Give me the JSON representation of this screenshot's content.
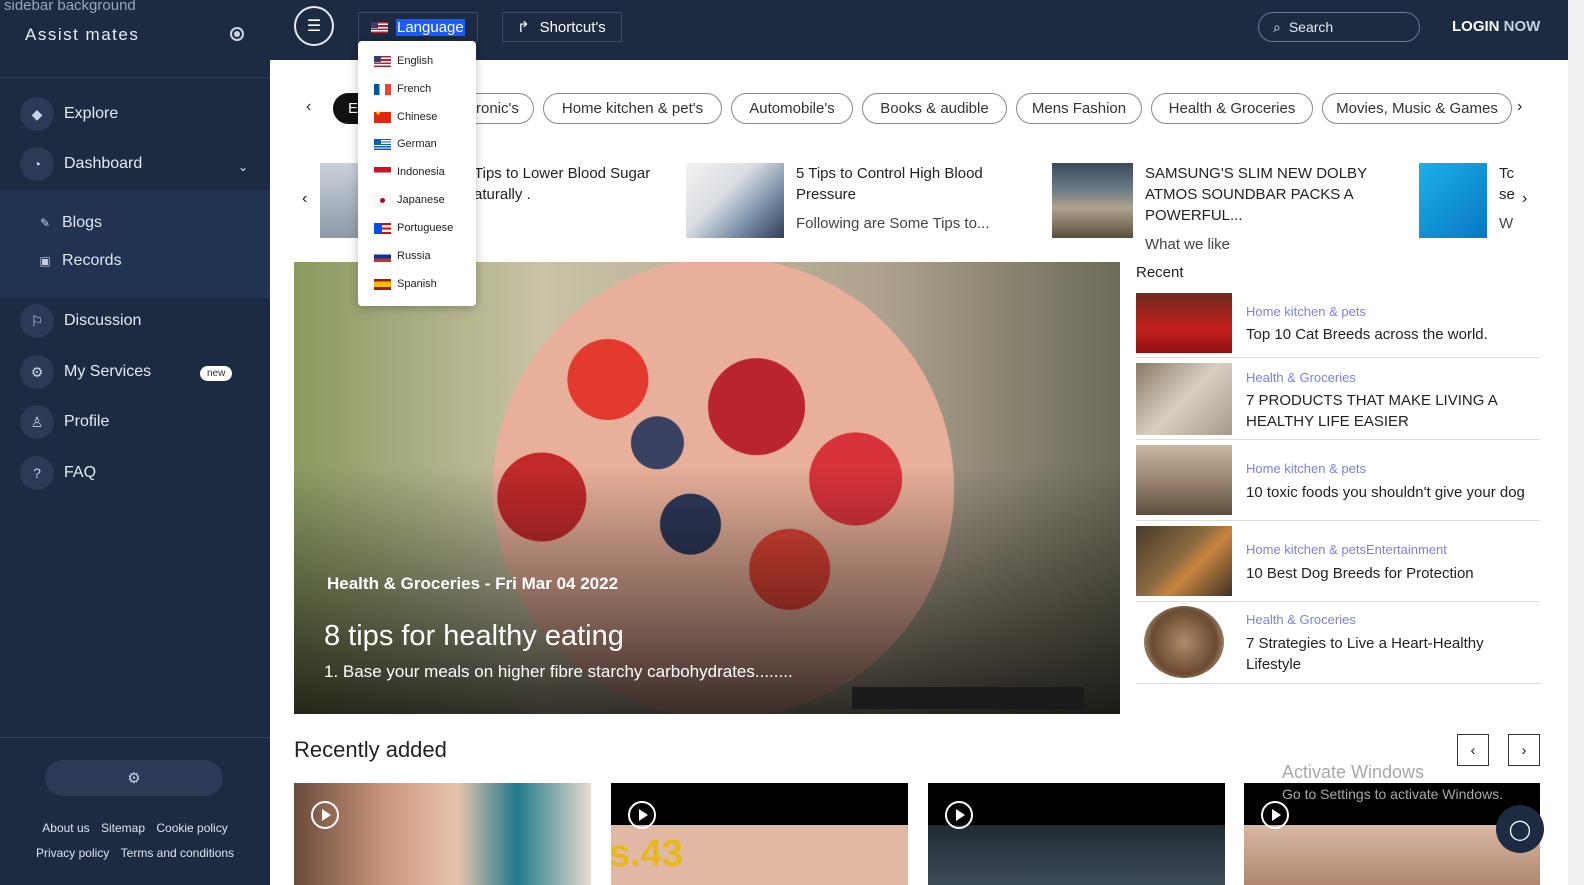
{
  "sidebar": {
    "bg_alt_text": "sidebar background",
    "brand": "Assist mates",
    "nav": [
      {
        "label": "Explore",
        "icon": "gem-icon"
      },
      {
        "label": "Dashboard",
        "icon": "gauge-icon"
      },
      {
        "label": "Discussion",
        "icon": "discussion-icon"
      },
      {
        "label": "My Services",
        "icon": "services-icon",
        "badge": "new"
      },
      {
        "label": "Profile",
        "icon": "profile-icon"
      },
      {
        "label": "FAQ",
        "icon": "question-icon"
      }
    ],
    "sub": [
      {
        "label": "Blogs",
        "icon": "pen-icon"
      },
      {
        "label": "Records",
        "icon": "video-icon"
      }
    ],
    "footer_links": [
      "About us",
      "Sitemap",
      "Cookie policy",
      "Privacy policy",
      "Terms and conditions"
    ]
  },
  "topbar": {
    "language_label": "Language",
    "shortcut_label": "Shortcut's",
    "search_placeholder": "Search",
    "login_label": "LOGIN",
    "login_now": "NOW"
  },
  "languages": [
    "English",
    "French",
    "Chinese",
    "German",
    "Indonesia",
    "Japanese",
    "Portuguese",
    "Russia",
    "Spanish"
  ],
  "categories": {
    "active_partial": "E",
    "items": [
      "ronic's",
      "Home kitchen & pet's",
      "Automobile's",
      "Books & audible",
      "Mens Fashion",
      "Health & Groceries",
      "Movies, Music & Games"
    ]
  },
  "news": [
    {
      "title": "Tips to Lower Blood Sugar aturally .",
      "sub": ""
    },
    {
      "title": "5 Tips to Control High Blood Pressure",
      "sub": "Following are Some Tips to..."
    },
    {
      "title": "SAMSUNG'S SLIM NEW DOLBY ATMOS SOUNDBAR PACKS A POWERFUL...",
      "sub": "What we like"
    },
    {
      "title": "Tc se",
      "sub": "W"
    }
  ],
  "hero": {
    "meta": "Health & Groceries - Fri Mar 04 2022",
    "title": "8 tips for healthy eating",
    "desc": "1. Base your meals on higher fibre starchy carbohydrates........"
  },
  "recent": {
    "heading": "Recent",
    "items": [
      {
        "category": "Home kitchen & pets",
        "title": "Top 10 Cat Breeds across the world."
      },
      {
        "category": "Health & Groceries",
        "title": "7 PRODUCTS THAT MAKE LIVING A HEALTHY LIFE EASIER"
      },
      {
        "category": "Home kitchen & pets",
        "title": "10 toxic foods you shouldn't give your dog"
      },
      {
        "category": "Home kitchen & petsEntertainment",
        "title": "10 Best Dog Breeds for Protection"
      },
      {
        "category": "Health & Groceries",
        "title": "7 Strategies to Live a Heart-Healthy Lifestyle"
      }
    ]
  },
  "recently_added": {
    "heading": "Recently added",
    "video2_overlay": "s.43"
  },
  "windows": {
    "line1": "Activate Windows",
    "line2": "Go to Settings to activate Windows."
  },
  "colors": {
    "sidebar_bg": "#1c2a42",
    "accent_link": "#7f80d6",
    "highlight": "#1a5cff"
  }
}
